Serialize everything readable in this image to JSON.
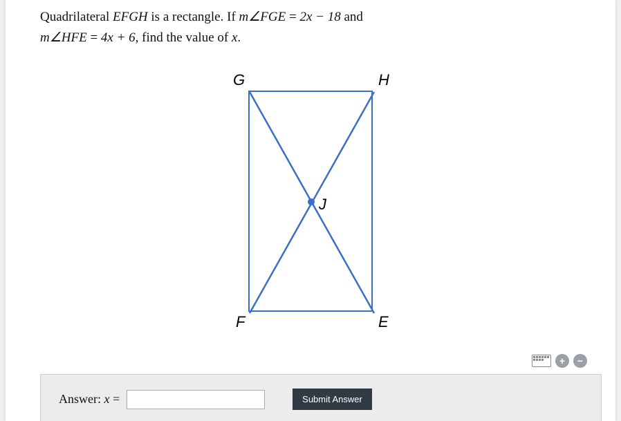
{
  "problem": {
    "line1_pre": "Quadrilateral ",
    "shape_name": "EFGH",
    "line1_mid": " is a rectangle. If ",
    "angle1_prefix": "m∠FGE",
    "eq": " = ",
    "expr1": "2x − 18",
    "and": " and",
    "angle2_prefix": "m∠HFE",
    "expr2": "4x + 6",
    "line2_tail": ", find the value of ",
    "var": "x",
    "period": "."
  },
  "labels": {
    "G": "G",
    "H": "H",
    "F": "F",
    "E": "E",
    "J": "J"
  },
  "answer": {
    "label_pre": "Answer: ",
    "var": "x",
    "eq": " = ",
    "value": "",
    "submit": "Submit Answer"
  },
  "icons": {
    "keyboard": "keyboard-icon",
    "plus": "+",
    "minus": "−"
  }
}
